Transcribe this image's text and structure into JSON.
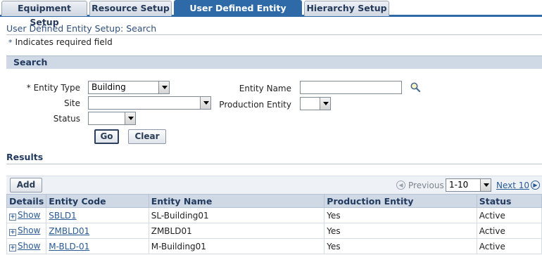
{
  "tabs": [
    {
      "label": "Equipment Setup"
    },
    {
      "label": "Resource Setup"
    },
    {
      "label": "User Defined Entity Setup"
    },
    {
      "label": "Hierarchy Setup"
    }
  ],
  "page": {
    "title": "User Defined Entity Setup: Search",
    "required_star": "*",
    "required_note": "Indicates required field"
  },
  "search": {
    "header": "Search",
    "entity_type_label": "* Entity Type",
    "entity_type_value": "Building",
    "site_label": "Site",
    "site_value": "",
    "status_label": "Status",
    "status_value": "",
    "entity_name_label": "Entity Name",
    "entity_name_value": "",
    "production_entity_label": "Production Entity",
    "production_entity_value": "",
    "go_label": "Go",
    "clear_label": "Clear"
  },
  "results": {
    "title": "Results",
    "add_label": "Add",
    "previous_label": "Previous",
    "range_value": "1-10",
    "next_label": "Next 10",
    "columns": [
      "Details",
      "Entity Code",
      "Entity Name",
      "Production Entity",
      "Status"
    ],
    "rows": [
      {
        "details": "Show",
        "code": "SBLD1",
        "name": "SL-Building01",
        "production": "Yes",
        "status": "Active"
      },
      {
        "details": "Show",
        "code": "ZMBLD01",
        "name": "ZMBLD01",
        "production": "Yes",
        "status": "Active"
      },
      {
        "details": "Show",
        "code": "M-BLD-01",
        "name": "M-Building01",
        "production": "Yes",
        "status": "Active"
      }
    ]
  },
  "colors": {
    "tab_active": "#2f6aa8",
    "header_bg": "#cfd9e6",
    "link": "#2a5a96"
  },
  "icons": {
    "search": "magnifier-icon",
    "expand": "plus-icon",
    "prev": "chevron-left-circle-icon",
    "next": "chevron-right-circle-icon"
  }
}
